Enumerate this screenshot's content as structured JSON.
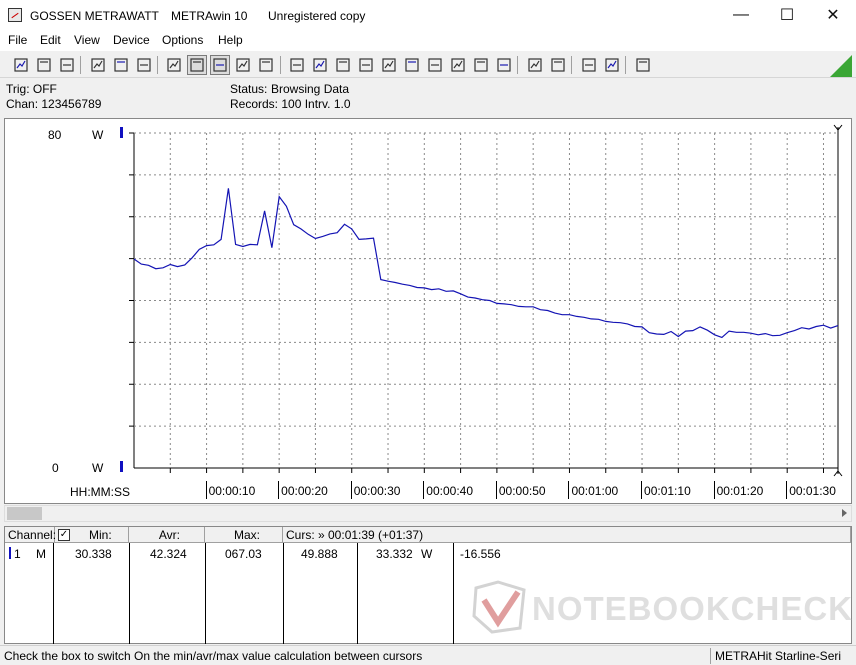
{
  "window": {
    "app_name": "GOSSEN METRAWATT",
    "product": "METRAwin 10",
    "license": "Unregistered copy",
    "minimize": "—",
    "maximize": "☐",
    "close": "✕"
  },
  "menu": {
    "file": "File",
    "edit": "Edit",
    "view": "View",
    "device": "Device",
    "options": "Options",
    "help": "Help"
  },
  "toolbar": {
    "icons": [
      "save-icon",
      "save-as-icon",
      "open-folder-icon",
      "print-preview-icon",
      "copy-icon",
      "export-icon",
      "table-view-icon",
      "trend-view-icon",
      "cursor-icon",
      "grid-icon",
      "histogram-icon",
      "zoom-icon",
      "channel-icon",
      "list-icon",
      "device-icon",
      "fx-icon",
      "scale-icon",
      "scope-icon",
      "wave-icon",
      "timer-icon",
      "trigger-icon",
      "printer-icon",
      "printer-alt-icon",
      "waveform-zoom-icon",
      "waveform-search-icon",
      "comment-icon"
    ],
    "corner_color": "#3aa635"
  },
  "status": {
    "trig": "Trig: OFF",
    "chan": "Chan:   123456789",
    "status_label": "Status:",
    "status_value": "Browsing Data",
    "records": "Records: 100   Intrv. 1.0"
  },
  "chart_data": {
    "type": "line",
    "ylim": [
      0,
      80
    ],
    "y_top_label": "80",
    "y_bottom_label": "0",
    "y_unit": "W",
    "x_axis_label": "HH:MM:SS",
    "x_ticks": [
      "00:00:10",
      "00:00:20",
      "00:00:30",
      "00:00:40",
      "00:00:50",
      "00:01:00",
      "00:01:10",
      "00:01:20",
      "00:01:30"
    ],
    "xlim": [
      0,
      97
    ],
    "line_color": "#1414b4",
    "series": [
      {
        "values": [
          49.9,
          48.7,
          48.4,
          47.6,
          47.8,
          48.6,
          48.1,
          48.5,
          50.2,
          52.2,
          53.1,
          53.3,
          54.6,
          66.8,
          53.4,
          52.9,
          53.4,
          53.3,
          61.4,
          52.6,
          64.8,
          62.5,
          58.1,
          57.1,
          55.8,
          54.8,
          55.3,
          55.9,
          56.2,
          58.2,
          57.1,
          54.6,
          54.7,
          54.9,
          45.0,
          44.6,
          44.3,
          43.9,
          43.6,
          43.1,
          43.0,
          42.6,
          42.8,
          42.2,
          42.3,
          41.6,
          40.8,
          40.6,
          40.2,
          40.0,
          39.3,
          39.2,
          39.0,
          38.6,
          38.5,
          38.5,
          37.8,
          37.6,
          37.0,
          36.6,
          36.6,
          36.2,
          36.0,
          35.6,
          35.5,
          35.0,
          34.8,
          34.7,
          34.4,
          33.8,
          33.7,
          32.3,
          32.0,
          31.9,
          32.6,
          31.4,
          32.7,
          32.8,
          33.7,
          32.9,
          31.8,
          31.2,
          32.7,
          32.4,
          32.4,
          32.2,
          31.8,
          32.1,
          31.6,
          31.7,
          32.3,
          32.8,
          33.5,
          33.2,
          33.8,
          34.1,
          33.4,
          34.0
        ]
      }
    ]
  },
  "table": {
    "headers": {
      "channel": "Channel:",
      "check": "✓",
      "min": "Min:",
      "avr": "Avr:",
      "max": "Max:",
      "curs": "Curs: » 00:01:39 (+01:37)"
    },
    "row": {
      "index": "1",
      "label": "M",
      "min": "30.338",
      "avr": "42.324",
      "max": "067.03",
      "curs1": "49.888",
      "curs2": "33.332",
      "unit": "W",
      "delta": "-16.556"
    }
  },
  "watermark": "NOTEBOOKCHECK",
  "statusbar": {
    "message": "Check the box to switch On the min/avr/max value calculation between cursors",
    "device": "METRAHit Starline-Seri"
  }
}
